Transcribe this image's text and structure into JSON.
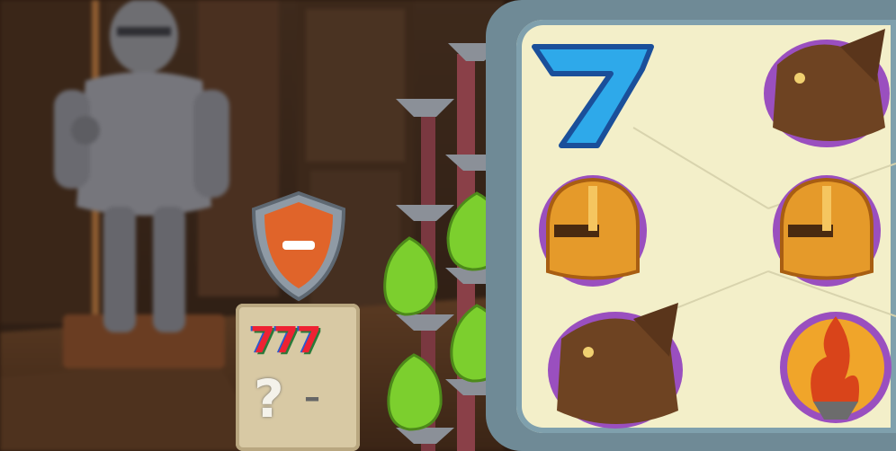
{
  "scene": {
    "background": "dungeon-hall",
    "decor": [
      "knight-armor-statue",
      "wooden-door",
      "spiked-poles-with-pears"
    ]
  },
  "shield_button": {
    "icon": "minus-icon",
    "color": "#e0642a"
  },
  "paytable_scroll": {
    "title": "777",
    "hint": "?",
    "dash": "–"
  },
  "reels": {
    "rows": [
      [
        "seven",
        "gargoyle"
      ],
      [
        "golden-helmet",
        "golden-helmet"
      ],
      [
        "gargoyle",
        "torch"
      ]
    ]
  }
}
